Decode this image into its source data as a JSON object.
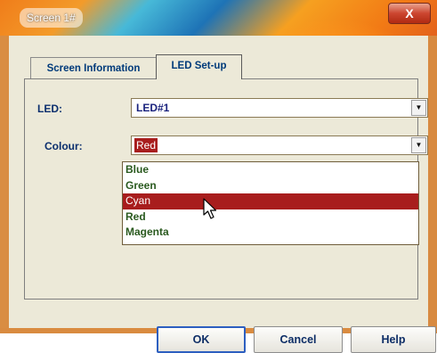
{
  "window": {
    "title": "Screen 1#",
    "close_label": "X"
  },
  "tabs": [
    {
      "label": "Screen Information",
      "active": false
    },
    {
      "label": "LED Set-up",
      "active": true
    }
  ],
  "form": {
    "led_label": "LED:",
    "led_value": "LED#1",
    "colour_label": "Colour:",
    "colour_value": "Red"
  },
  "dropdown": {
    "options": [
      "Blue",
      "Green",
      "Cyan",
      "Red",
      "Magenta"
    ],
    "highlighted": "Cyan"
  },
  "buttons": {
    "ok": "OK",
    "cancel": "Cancel",
    "help": "Help"
  },
  "colors": {
    "selection": "#a81d1d",
    "label_text": "#0b2f6e",
    "client_bg": "#ece9d8"
  }
}
